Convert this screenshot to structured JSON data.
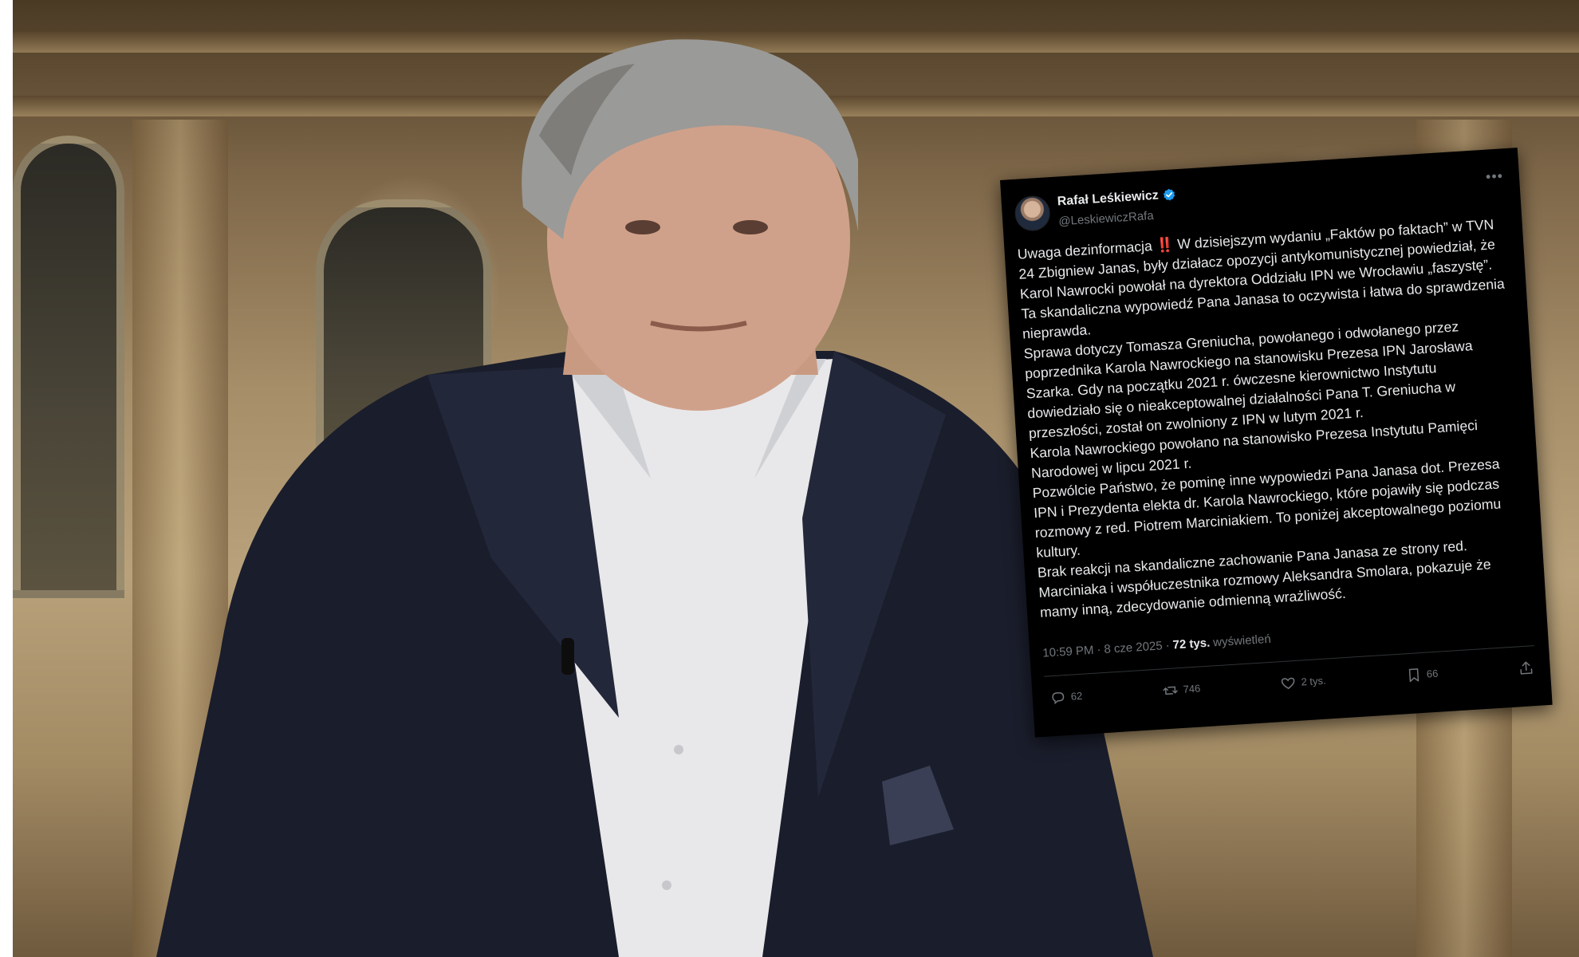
{
  "tweet": {
    "author": {
      "display_name": "Rafał Leśkiewicz",
      "handle": "@LeskiewiczRafa",
      "verified_icon": "verified-badge-icon"
    },
    "more_icon": "more-dots-icon",
    "paragraphs": [
      {
        "before_emoji": "Uwaga dezinformacja ",
        "emoji": "‼️",
        "after_emoji": " W dzisiejszym wydaniu „Faktów po faktach” w TVN 24 Zbigniew Janas, były działacz opozycji antykomunistycznej powiedział, że Karol Nawrocki powołał na dyrektora Oddziału IPN we Wrocławiu „faszystę”."
      },
      {
        "text": "Ta skandaliczna wypowiedź Pana Janasa to oczywista i łatwa do sprawdzenia nieprawda."
      },
      {
        "text": "Sprawa dotyczy Tomasza Greniucha, powołanego i odwołanego przez poprzednika Karola Nawrockiego na stanowisku Prezesa IPN Jarosława Szarka. Gdy na początku 2021 r. ówczesne kierownictwo Instytutu dowiedziało się o nieakceptowalnej działalności Pana T. Greniucha w przeszłości, został on zwolniony z IPN w lutym 2021 r."
      },
      {
        "text": "Karola Nawrockiego powołano na stanowisko Prezesa Instytutu Pamięci Narodowej w lipcu 2021 r."
      },
      {
        "text": "Pozwólcie Państwo, że pominę inne wypowiedzi Pana Janasa dot. Prezesa IPN i Prezydenta elekta dr. Karola Nawrockiego, które pojawiły się podczas rozmowy z red. Piotrem Marciniakiem. To poniżej akceptowalnego poziomu kultury."
      },
      {
        "text": "Brak reakcji na skandaliczne zachowanie Pana Janasa ze strony red. Marciniaka i współuczestnika rozmowy Aleksandra Smolara, pokazuje że mamy inną, zdecydowanie odmienną wrażliwość."
      }
    ],
    "meta": {
      "time": "10:59 PM",
      "separator": "·",
      "date": "8 cze 2025",
      "views_count": "72 tys.",
      "views_label": "wyświetleń"
    },
    "actions": {
      "replies": "62",
      "reposts": "746",
      "likes": "2 tys.",
      "bookmarks": "66"
    },
    "colors": {
      "card_bg": "#000000",
      "text": "#e7e9ea",
      "muted": "#71767b",
      "verified": "#1d9bf0",
      "emoji_red": "#f4212e"
    }
  }
}
